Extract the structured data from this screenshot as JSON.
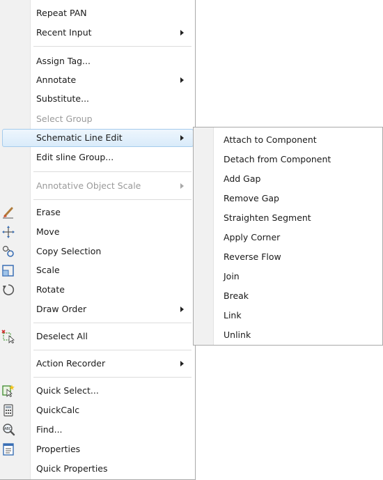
{
  "main_menu": {
    "repeat_pan": "Repeat PAN",
    "recent_input": "Recent Input",
    "assign_tag": "Assign Tag...",
    "annotate": "Annotate",
    "substitute": "Substitute...",
    "select_group": "Select Group",
    "schematic_line_edit": "Schematic Line Edit",
    "edit_sline_group": "Edit sline Group...",
    "annotative_object_scale": "Annotative Object Scale",
    "erase": "Erase",
    "move": "Move",
    "copy_selection": "Copy Selection",
    "scale": "Scale",
    "rotate": "Rotate",
    "draw_order": "Draw Order",
    "deselect_all": "Deselect All",
    "action_recorder": "Action Recorder",
    "quick_select": "Quick Select...",
    "quickcalc": "QuickCalc",
    "find": "Find...",
    "properties": "Properties",
    "quick_properties": "Quick Properties"
  },
  "submenu": {
    "items": [
      "Attach to Component",
      "Detach from Component",
      "Add Gap",
      "Remove Gap",
      "Straighten Segment",
      "Apply Corner",
      "Reverse Flow",
      "Join",
      "Break",
      "Link",
      "Unlink"
    ]
  },
  "icons": {
    "erase": "eraser-icon",
    "move": "move-icon",
    "copy_selection": "copy-icon",
    "scale": "scale-icon",
    "rotate": "rotate-icon",
    "deselect_all": "deselect-icon",
    "quick_select": "quick-select-icon",
    "quickcalc": "calculator-icon",
    "find": "find-icon",
    "properties": "properties-icon"
  },
  "colors": {
    "hover_border": "#a5cbec",
    "hover_fill": "#d9ebfa",
    "disabled_text": "#9a9a9a"
  }
}
